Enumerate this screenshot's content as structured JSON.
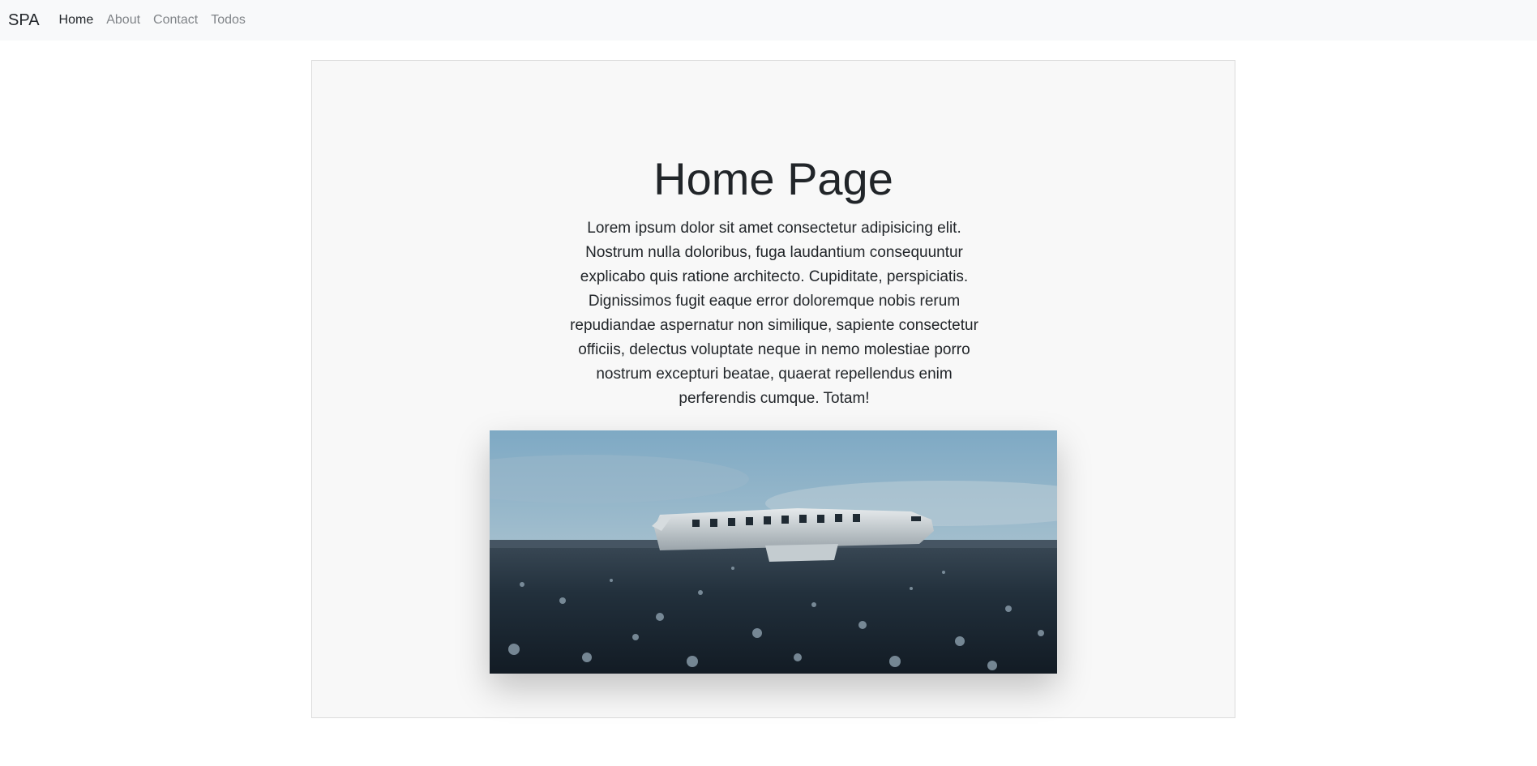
{
  "navbar": {
    "brand": "SPA",
    "links": [
      {
        "label": "Home",
        "active": true
      },
      {
        "label": "About",
        "active": false
      },
      {
        "label": "Contact",
        "active": false
      },
      {
        "label": "Todos",
        "active": false
      }
    ]
  },
  "main": {
    "title": "Home Page",
    "body": "Lorem ipsum dolor sit amet consectetur adipisicing elit. Nostrum nulla doloribus, fuga laudantium consequuntur explicabo quis ratione architecto. Cupiditate, perspiciatis. Dignissimos fugit eaque error doloremque nobis rerum repudiandae aspernatur non similique, sapiente consectetur officiis, delectus voluptate neque in nemo molestiae porro nostrum excepturi beatae, quaerat repellendus enim perferendis cumque. Totam!"
  },
  "colors": {
    "navbar_bg": "#f8f9fa",
    "card_bg": "#f8f8f8",
    "text": "#212529",
    "muted_link": "#808488"
  }
}
